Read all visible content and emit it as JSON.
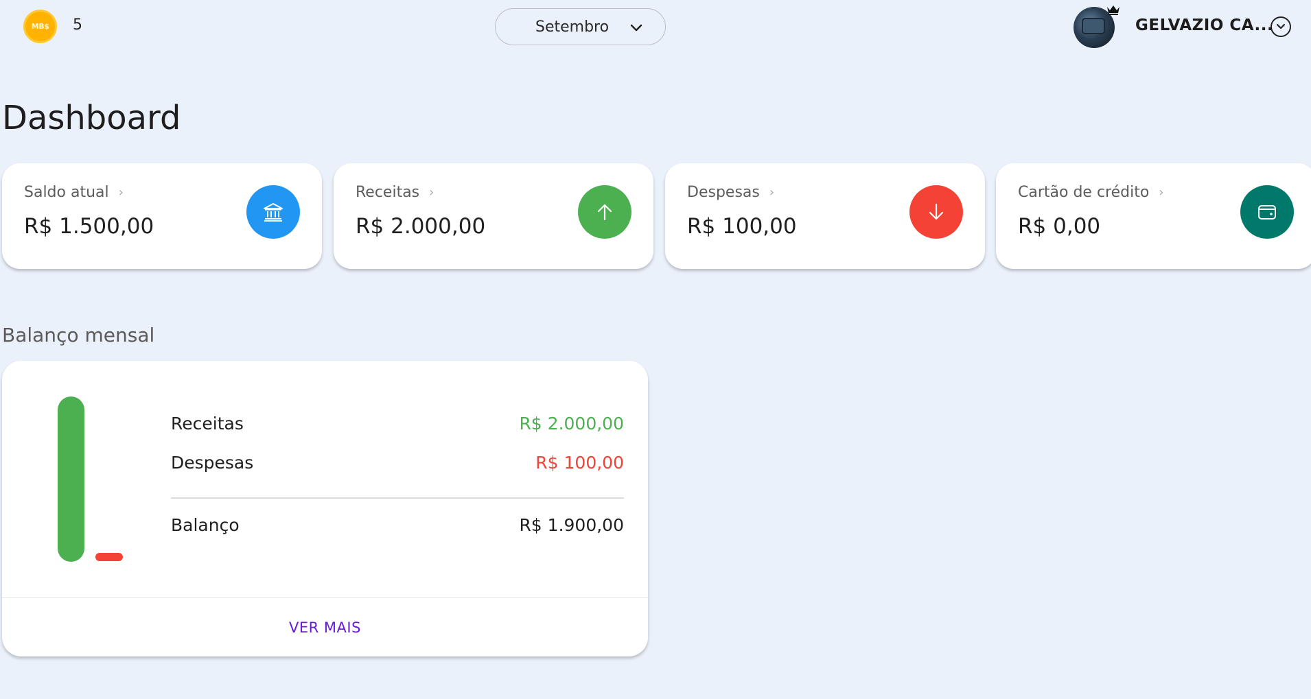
{
  "header": {
    "coin_badge": "MB$",
    "coin_count": "5",
    "month": "Setembro",
    "user_name": "GELVAZIO CA..."
  },
  "page": {
    "title": "Dashboard"
  },
  "cards": [
    {
      "label": "Saldo atual",
      "value": "R$ 1.500,00",
      "icon": "bank-icon",
      "color": "#2196f3"
    },
    {
      "label": "Receitas",
      "value": "R$ 2.000,00",
      "icon": "arrow-up-icon",
      "color": "#4caf50"
    },
    {
      "label": "Despesas",
      "value": "R$ 100,00",
      "icon": "arrow-down-icon",
      "color": "#f44336"
    },
    {
      "label": "Cartão de crédito",
      "value": "R$ 0,00",
      "icon": "wallet-icon",
      "color": "#00796b"
    }
  ],
  "balance": {
    "section_title": "Balanço mensal",
    "receitas_label": "Receitas",
    "receitas_value": "R$ 2.000,00",
    "despesas_label": "Despesas",
    "despesas_value": "R$ 100,00",
    "balanco_label": "Balanço",
    "balanco_value": "R$ 1.900,00",
    "ver_mais": "VER MAIS",
    "colors": {
      "receitas": "#4caf50",
      "despesas": "#f44336"
    }
  }
}
